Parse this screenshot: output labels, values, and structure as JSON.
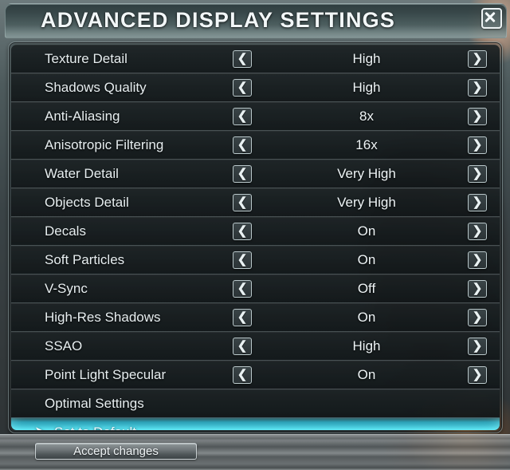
{
  "window": {
    "title": "ADVANCED DISPLAY SETTINGS",
    "close_icon": "close-x-icon"
  },
  "colors": {
    "highlight_cyan": "#60ecfa",
    "title_text": "#f2f7f8",
    "row_text": "#e7eef0",
    "row_bg": "#1c2224",
    "separator": "#c4d4d6",
    "bottom_bar": "#8a9092"
  },
  "controls": {
    "left_arrow_icon": "chevron-left-icon",
    "right_arrow_icon": "chevron-right-icon",
    "left_arrow_glyph": "❮",
    "right_arrow_glyph": "❯",
    "selection_marker": "➤"
  },
  "settings": [
    {
      "label": "Texture Detail",
      "value": "High",
      "has_arrows": true
    },
    {
      "label": "Shadows Quality",
      "value": "High",
      "has_arrows": true
    },
    {
      "label": "Anti-Aliasing",
      "value": "8x",
      "has_arrows": true
    },
    {
      "label": "Anisotropic Filtering",
      "value": "16x",
      "has_arrows": true
    },
    {
      "label": "Water Detail",
      "value": "Very High",
      "has_arrows": true
    },
    {
      "label": "Objects Detail",
      "value": "Very High",
      "has_arrows": true
    },
    {
      "label": "Decals",
      "value": "On",
      "has_arrows": true
    },
    {
      "label": "Soft Particles",
      "value": "On",
      "has_arrows": true
    },
    {
      "label": "V-Sync",
      "value": "Off",
      "has_arrows": true
    },
    {
      "label": "High-Res Shadows",
      "value": "On",
      "has_arrows": true
    },
    {
      "label": "SSAO",
      "value": "High",
      "has_arrows": true
    },
    {
      "label": "Point Light Specular",
      "value": "On",
      "has_arrows": true
    },
    {
      "label": "Optimal Settings",
      "value": "",
      "has_arrows": false
    },
    {
      "label": "Set to Default",
      "value": "",
      "has_arrows": false,
      "selected": true
    }
  ],
  "footer": {
    "accept_label": "Accept changes"
  }
}
